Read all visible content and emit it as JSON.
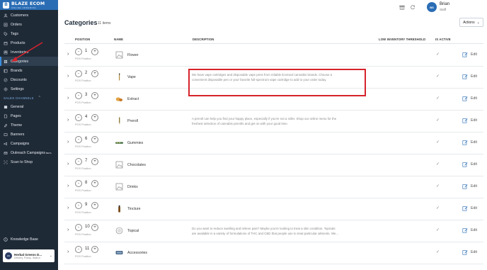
{
  "sidebar": {
    "logo": {
      "name": "BLAZE ECOM",
      "sub": "ONLINE ORDERING"
    },
    "items": [
      {
        "label": "Customers",
        "icon": "user-icon"
      },
      {
        "label": "Orders",
        "icon": "orders-icon"
      },
      {
        "label": "Tags",
        "icon": "tag-icon"
      },
      {
        "label": "Products",
        "icon": "box-icon"
      },
      {
        "label": "Inventories",
        "icon": "inventory-icon"
      },
      {
        "label": "Categories",
        "icon": "categories-icon",
        "active": true
      },
      {
        "label": "Brands",
        "icon": "brand-icon"
      },
      {
        "label": "Discounts",
        "icon": "discount-icon"
      },
      {
        "label": "Settings",
        "icon": "gear-icon"
      }
    ],
    "sales_channels_label": "SALES CHANNELS",
    "channel_items": [
      {
        "label": "General",
        "icon": "general-icon"
      },
      {
        "label": "Pages",
        "icon": "page-icon"
      },
      {
        "label": "Theme",
        "icon": "theme-icon"
      },
      {
        "label": "Banners",
        "icon": "banner-icon"
      },
      {
        "label": "Campaigns",
        "icon": "campaign-icon"
      },
      {
        "label": "Outreach Campaigns",
        "sup": "BETA",
        "icon": "outreach-icon"
      },
      {
        "label": "Scan to Shop",
        "icon": "scan-icon"
      }
    ],
    "knowledge_base": "Knowledge Base",
    "store": {
      "name": "Herbal Greens D...",
      "sub": "Delivery, Pickup, Walk-in"
    }
  },
  "header": {
    "user_name": "Brian",
    "user_role": "Staff",
    "avatar_initials": "BS"
  },
  "page": {
    "title": "Categories",
    "count": "11 items",
    "actions_label": "Actions"
  },
  "table": {
    "headers": {
      "position": "POSITION",
      "name": "NAME",
      "description": "DESCRIPTION",
      "low_inventory": "LOW INVENTORY THRESHOLD",
      "is_active": "IS ACTIVE"
    },
    "pos_label": "POS Position",
    "edit_label": "Edit",
    "rows": [
      {
        "position": "1",
        "name": "Flower",
        "desc_lines": [],
        "thumb": "image-placeholder-icon"
      },
      {
        "position": "2",
        "name": "Vape",
        "desc_lines": [
          "We have vape cartridges and disposable vape pens from reliable licensed cannabis brands. Choose a",
          "convenient disposable pen or your favorite full-spectrum vape cartridge to add to your order today."
        ],
        "thumb": "vape-pen-icon"
      },
      {
        "position": "3",
        "name": "Extract",
        "desc_lines": [],
        "thumb": "extract-icon"
      },
      {
        "position": "4",
        "name": "Preroll",
        "desc_lines": [
          "A preroll can help you find your happy place, especially if you're not a roller. Shop our online menu for the",
          "freshest selection of cannabis prerolls and get on with your good time."
        ],
        "thumb": "preroll-icon"
      },
      {
        "position": "6",
        "name": "Gummies",
        "desc_lines": [],
        "thumb": "gummies-icon"
      },
      {
        "position": "7",
        "name": "Chocolates",
        "desc_lines": [],
        "thumb": "image-placeholder-icon"
      },
      {
        "position": "8",
        "name": "Drinks",
        "desc_lines": [],
        "thumb": "image-placeholder-icon"
      },
      {
        "position": "9",
        "name": "Tincture",
        "desc_lines": [],
        "thumb": "tincture-icon"
      },
      {
        "position": "10",
        "name": "Topical",
        "desc_lines": [
          "Do you want to reduce swelling and relieve pain? Maybe you're looking to treat a skin condition. Topicals",
          "are available in a variety of formulations of THC and CBD that people use to treat particular ailments. We..."
        ],
        "thumb": "topical-icon"
      },
      {
        "position": "11",
        "name": "Accessories",
        "desc_lines": [],
        "thumb": "accessories-icon"
      }
    ]
  },
  "colors": {
    "sidebar_bg": "#1f2a37",
    "brand_blue": "#2a6db5",
    "highlight_red": "#d6232c"
  }
}
